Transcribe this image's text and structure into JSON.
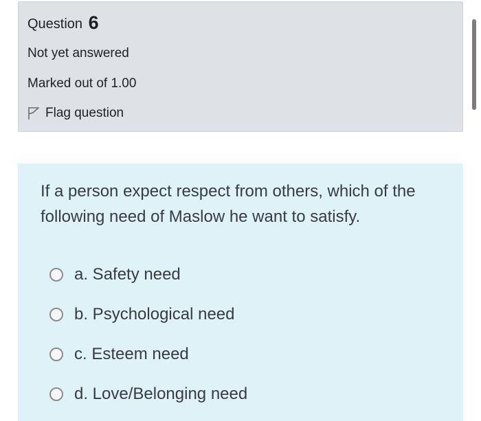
{
  "question_info": {
    "label": "Question",
    "number": "6",
    "state": "Not yet answered",
    "grade": "Marked out of 1.00",
    "flag_label": "Flag question"
  },
  "question_text": "If a person expect respect from others, which of the following need of Maslow he want to satisfy.",
  "answers": [
    {
      "label": "a. Safety need",
      "selected": false
    },
    {
      "label": "b. Psychological need",
      "selected": false
    },
    {
      "label": "c. Esteem need",
      "selected": false
    },
    {
      "label": "d. Love/Belonging need",
      "selected": false
    }
  ],
  "colors": {
    "info_background": "#dee2e6",
    "content_background": "#def2f8",
    "text": "#383c40"
  },
  "icons": {
    "flag": "flag-outline-icon",
    "radio": "radio-unchecked-icon"
  }
}
